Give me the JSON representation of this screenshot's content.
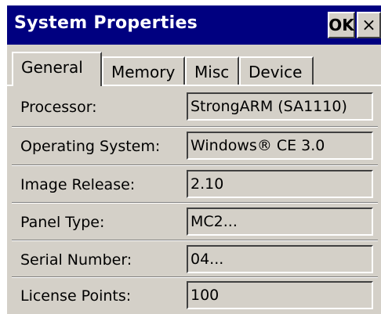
{
  "window": {
    "title": "System Properties",
    "ok_label": "OK",
    "close_glyph": "×"
  },
  "tabs": [
    {
      "label": "General",
      "active": true
    },
    {
      "label": "Memory",
      "active": false
    },
    {
      "label": "Misc",
      "active": false
    },
    {
      "label": "Device",
      "active": false
    }
  ],
  "properties": [
    {
      "label": "Processor:",
      "value": "StrongARM (SA1110)"
    },
    {
      "label": "Operating System:",
      "value": "Windows® CE 3.0"
    },
    {
      "label": "Image Release:",
      "value": "2.10"
    },
    {
      "label": "Panel Type:",
      "value": "MC2..."
    },
    {
      "label": "Serial Number:",
      "value": "04..."
    },
    {
      "label": "License Points:",
      "value": "100"
    }
  ],
  "colors": {
    "titlebar": "#000080",
    "face": "#d4d0c8"
  }
}
